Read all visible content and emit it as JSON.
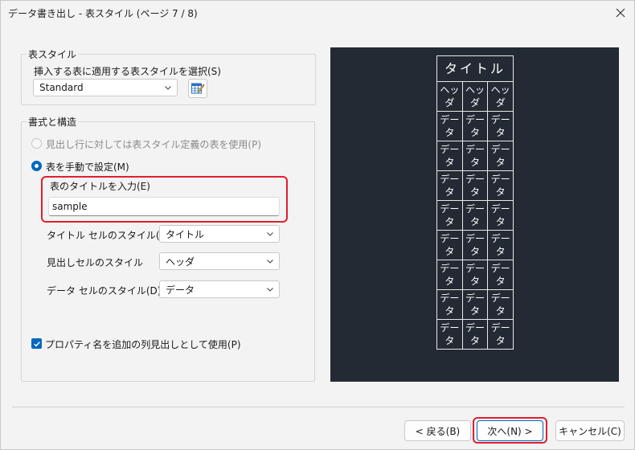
{
  "window": {
    "title": "データ書き出し - 表スタイル (ページ 7 / 8)"
  },
  "table_style": {
    "group_label": "表スタイル",
    "select_label": "挿入する表に適用する表スタイルを選択(S)",
    "selected": "Standard",
    "editor_icon": "table-style-editor-icon"
  },
  "format": {
    "group_label": "書式と構造",
    "option_use_style": "見出し行に対しては表スタイル定義の表を使用(P)",
    "option_manual": "表を手動で設定(M)",
    "title_label": "表のタイトルを入力(E)",
    "title_value": "sample",
    "title_cell_label": "タイトル セルのスタイル(T)",
    "title_cell_value": "タイトル",
    "header_cell_label": "見出しセルのスタイル",
    "header_cell_value": "ヘッダ",
    "data_cell_label": "データ セルのスタイル(D)",
    "data_cell_value": "データ",
    "property_names_label": "プロパティ名を追加の列見出しとして使用(P)"
  },
  "preview": {
    "title": "タイトル",
    "header": [
      "ヘッダ",
      "ヘッダ",
      "ヘッダ"
    ],
    "data_cell": "データ",
    "data_row_count": 8
  },
  "buttons": {
    "back": "< 戻る(B)",
    "next": "次へ(N) >",
    "cancel": "キャンセル(C)"
  },
  "colors": {
    "accent": "#0067c0",
    "highlight": "#e0202e",
    "preview_bg": "#232a33"
  }
}
